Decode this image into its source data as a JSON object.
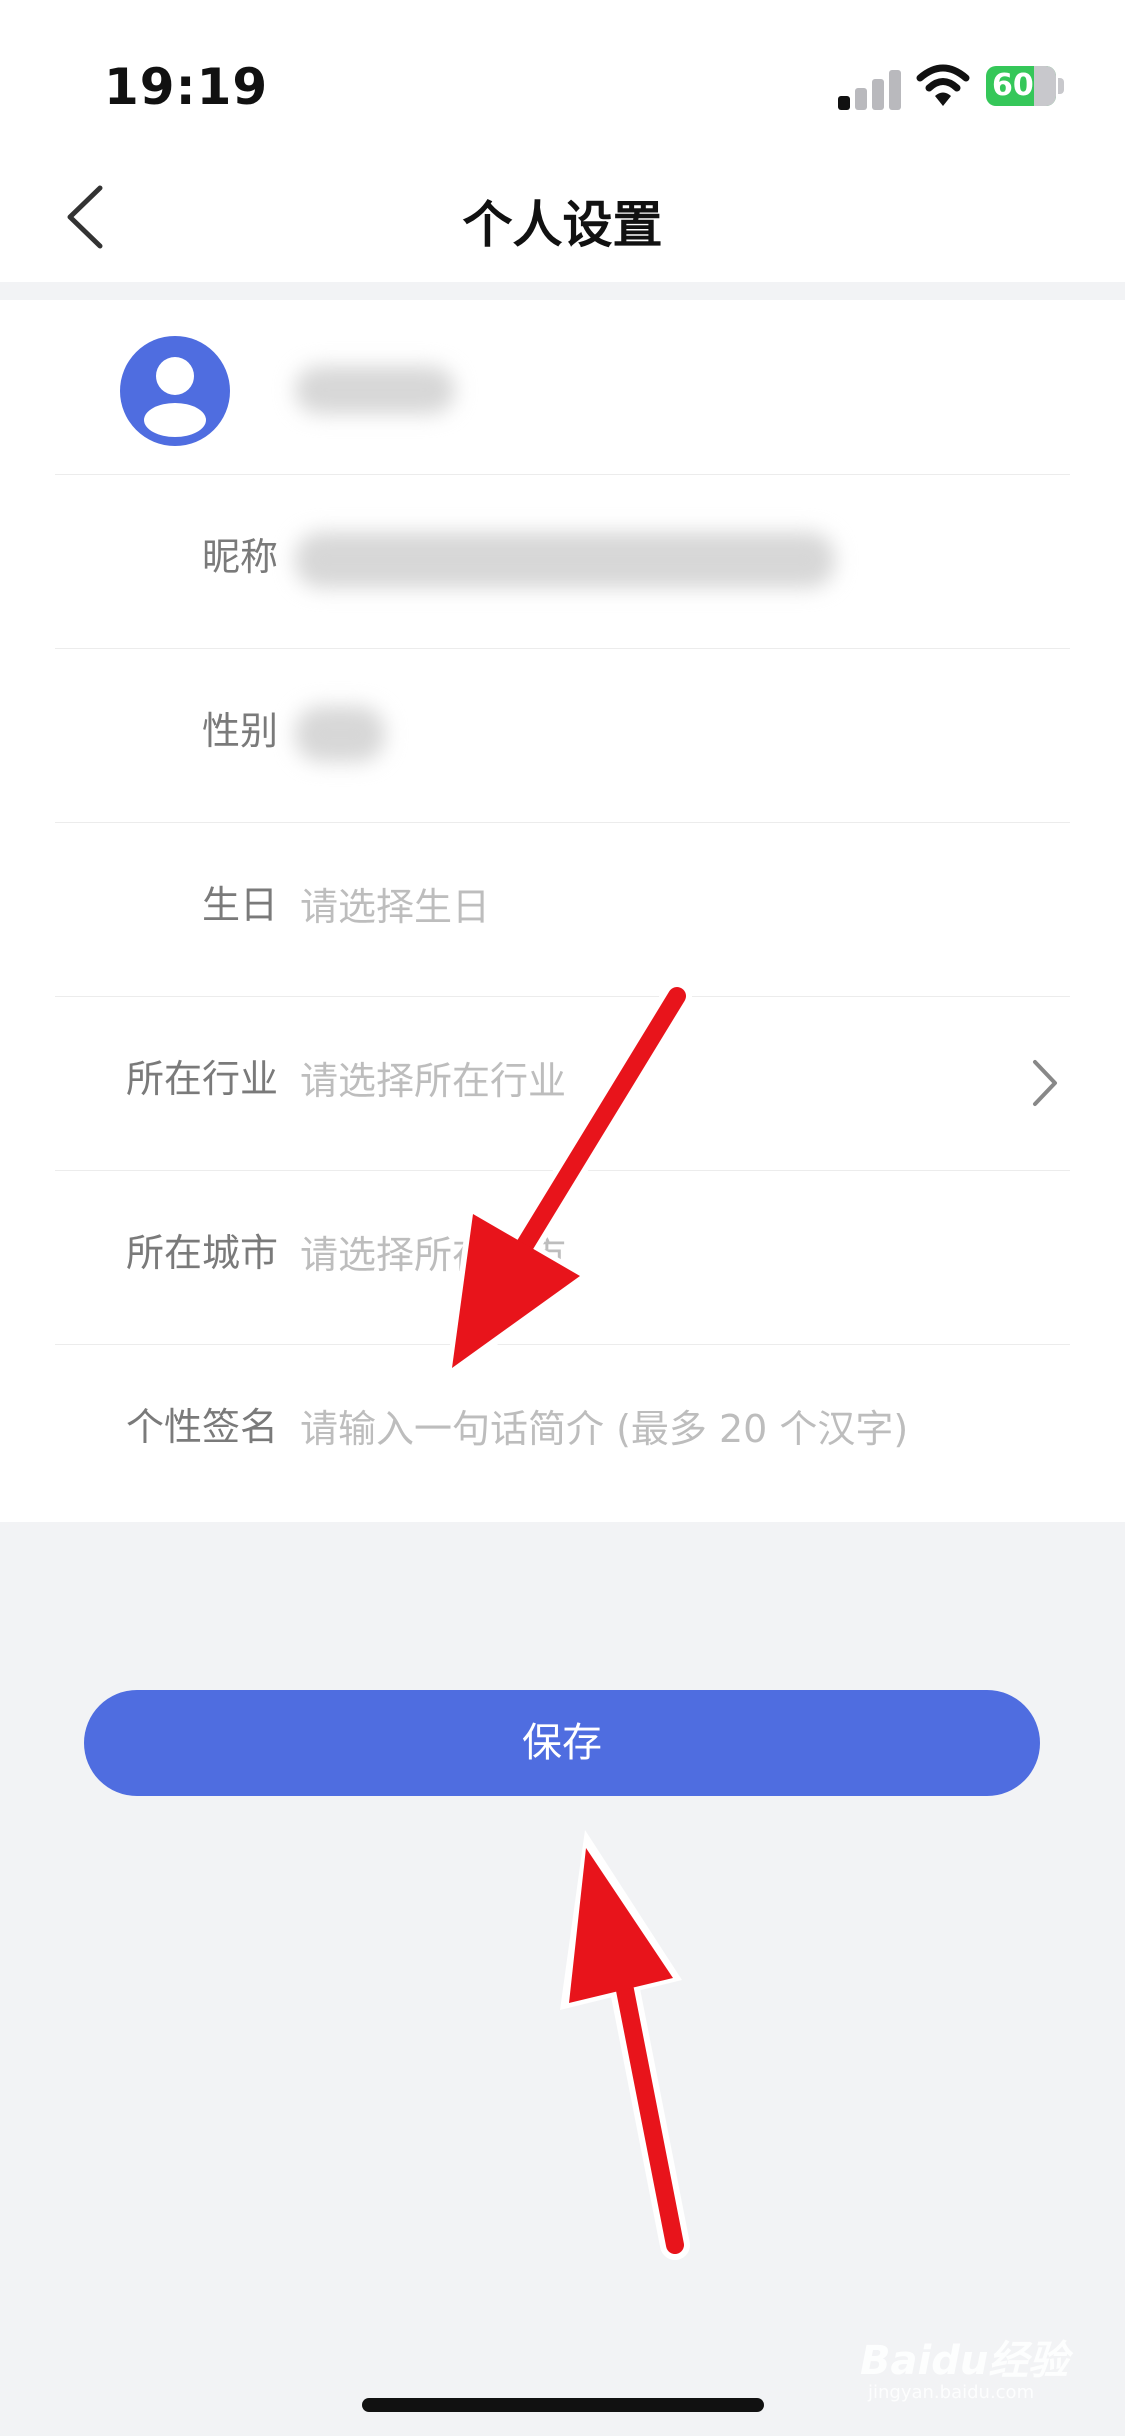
{
  "status_bar": {
    "time": "19:19",
    "battery": "60"
  },
  "nav": {
    "title": "个人设置"
  },
  "form": {
    "rows": [
      {
        "label": "昵称"
      },
      {
        "label": "性别"
      },
      {
        "label": "生日",
        "placeholder": "请选择生日"
      },
      {
        "label": "所在行业",
        "placeholder": "请选择所在行业"
      },
      {
        "label": "所在城市",
        "placeholder": "请选择所在城市"
      },
      {
        "label": "个性签名",
        "placeholder": "请输入一句话简介 (最多 20 个汉字)"
      }
    ]
  },
  "actions": {
    "save_label": "保存"
  },
  "icons": {
    "avatar": "user-avatar-icon",
    "back": "chevron-left-icon",
    "industry": "chevron-right-icon"
  },
  "colors": {
    "accent": "#4f6de0",
    "annotation_arrow": "#e8141b",
    "battery": "#35c759"
  },
  "watermark": {
    "brand": "Baidu经验",
    "url": "jingyan.baidu.com"
  }
}
